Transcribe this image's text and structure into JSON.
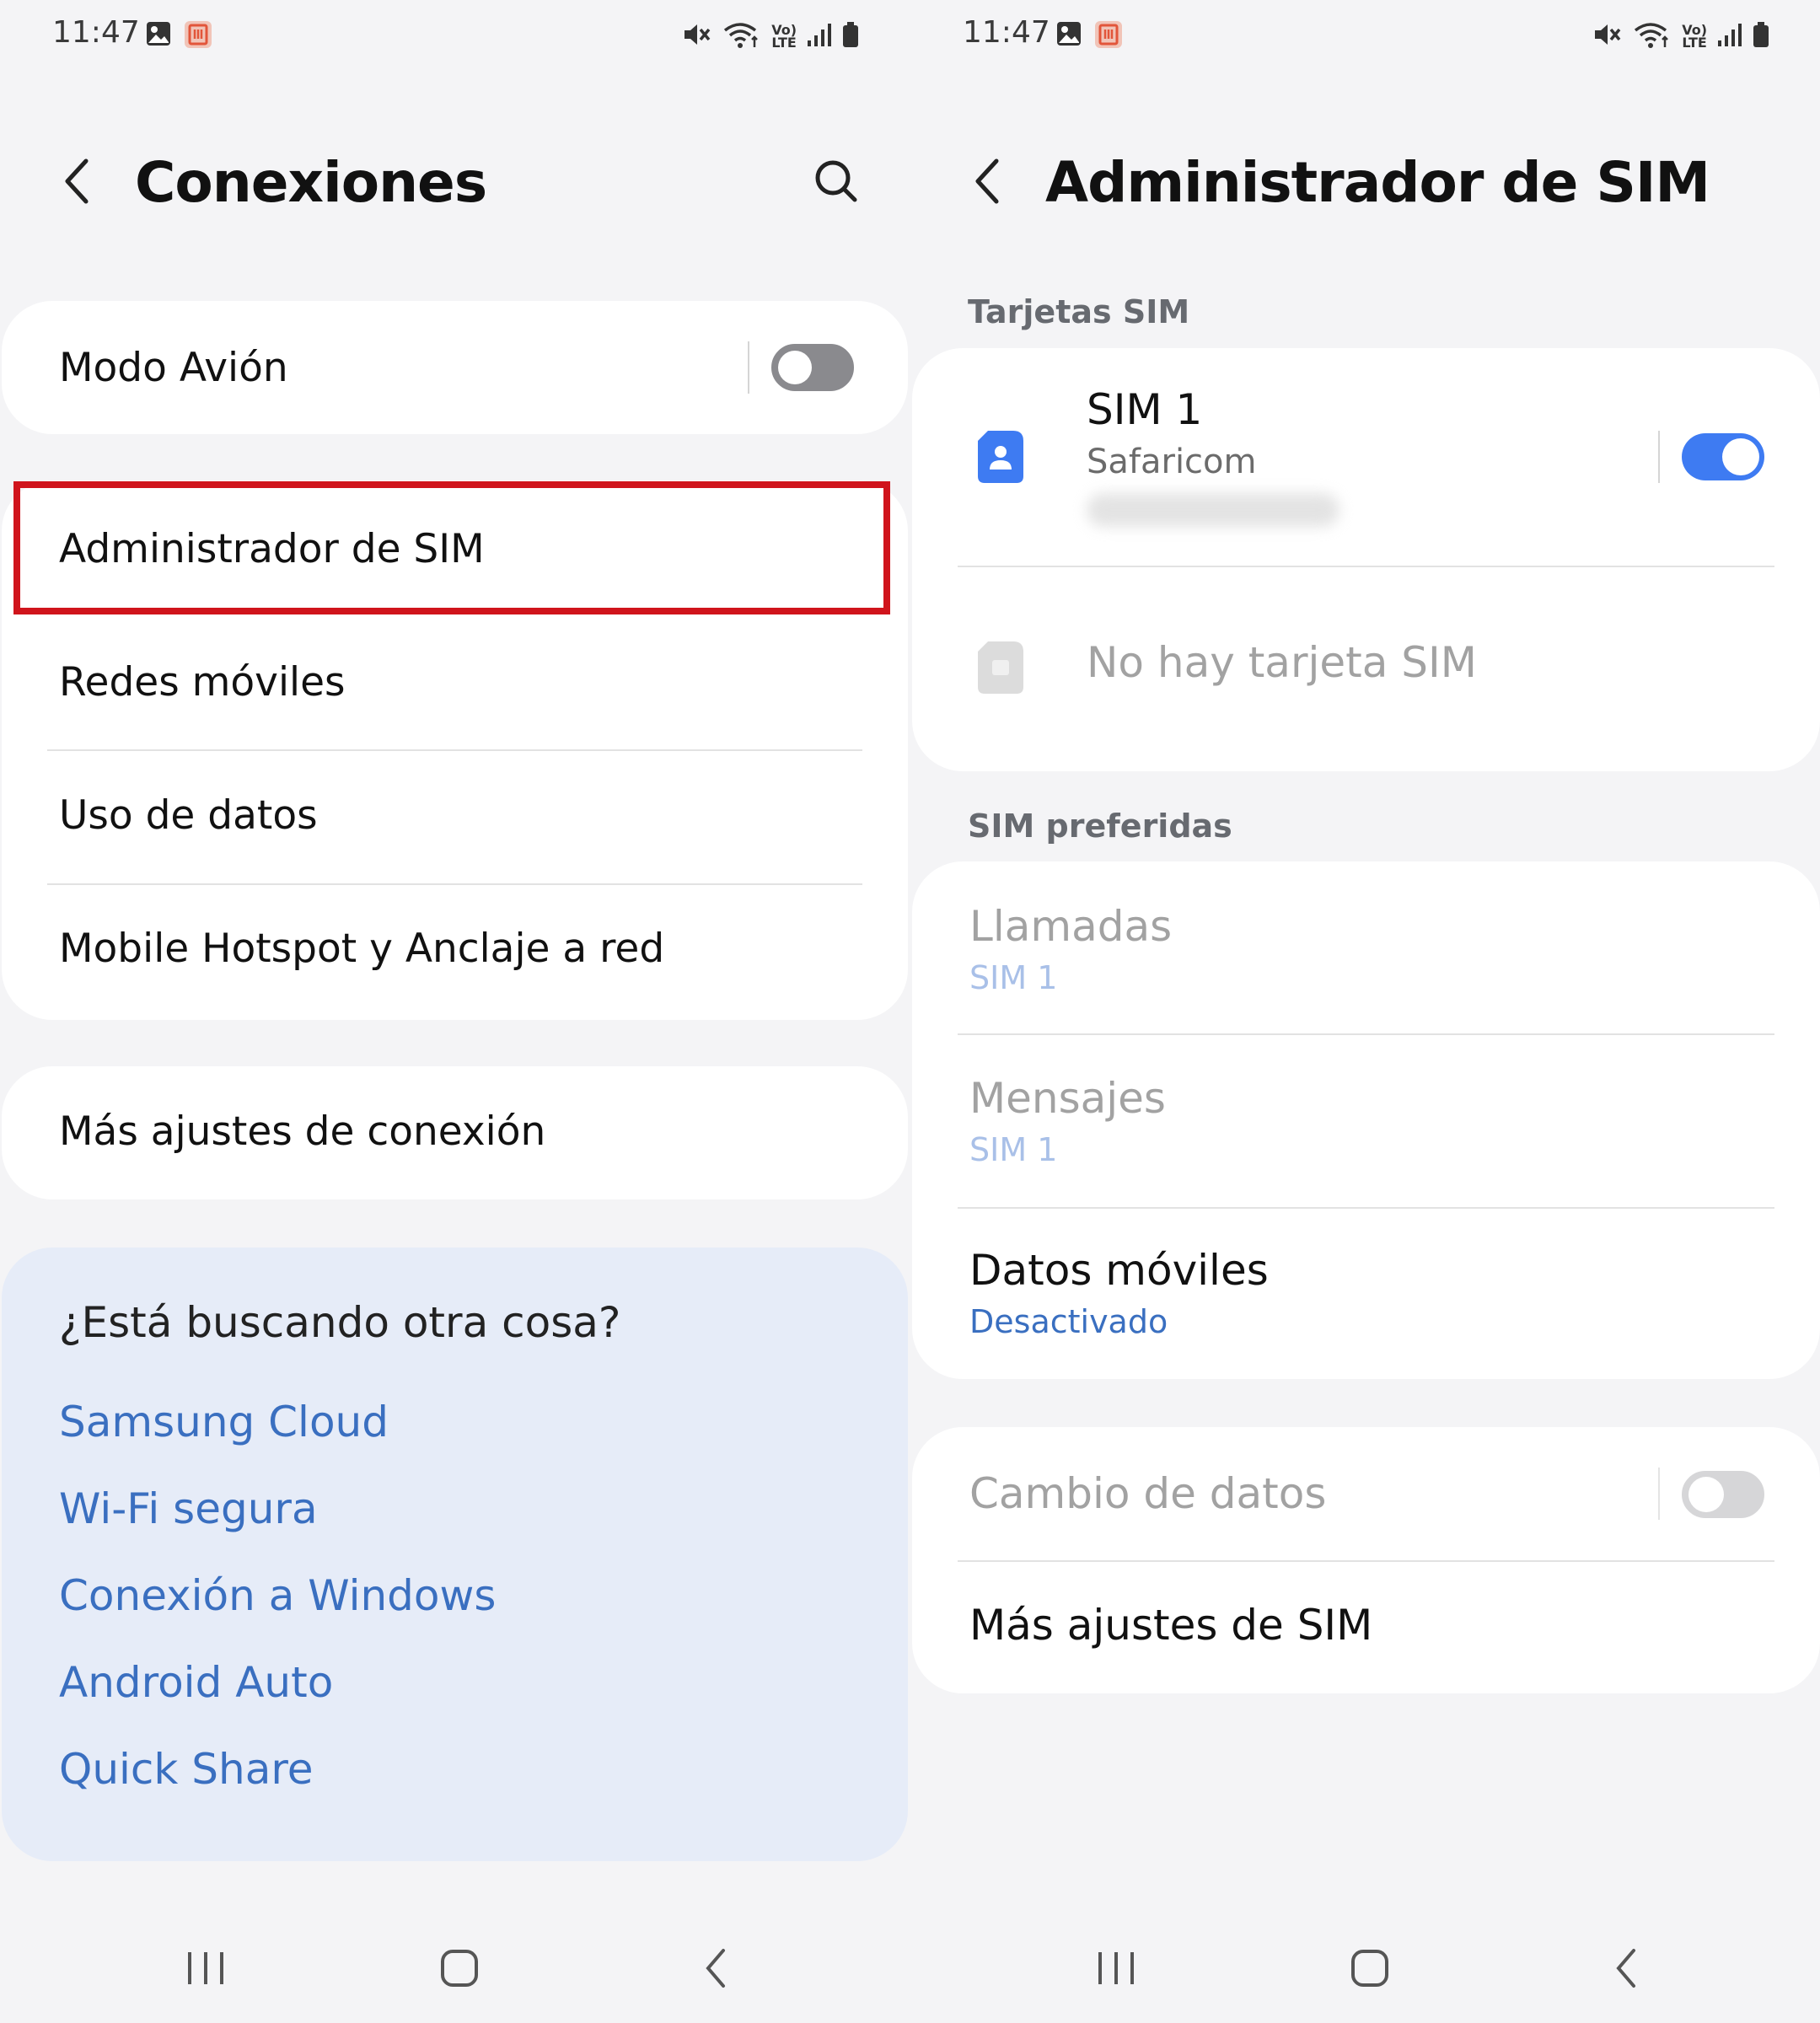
{
  "status_bar": {
    "time": "11:47",
    "volte_label": "Vo)",
    "lte_label": "LTE"
  },
  "left": {
    "header": {
      "title": "Conexiones"
    },
    "airplane": {
      "label": "Modo Avión",
      "enabled": false
    },
    "items": {
      "sim_manager": "Administrador de SIM",
      "mobile_networks": "Redes móviles",
      "data_usage": "Uso de datos",
      "hotspot": "Mobile Hotspot y Anclaje a red"
    },
    "more_settings": "Más ajustes de conexión",
    "suggestions": {
      "title": "¿Está buscando otra cosa?",
      "links": [
        "Samsung Cloud",
        "Wi-Fi segura",
        "Conexión a Windows",
        "Android Auto",
        "Quick Share"
      ]
    }
  },
  "right": {
    "header": {
      "title": "Administrador de SIM"
    },
    "sim_cards": {
      "section_label": "Tarjetas SIM",
      "sim1": {
        "name": "SIM 1",
        "carrier": "Safaricom",
        "enabled": true
      },
      "no_sim": "No hay tarjeta SIM"
    },
    "preferred": {
      "section_label": "SIM preferidas",
      "calls": {
        "label": "Llamadas",
        "value": "SIM 1"
      },
      "messages": {
        "label": "Mensajes",
        "value": "SIM 1"
      },
      "mobile_data": {
        "label": "Datos móviles",
        "value": "Desactivado"
      }
    },
    "data_switch": {
      "label": "Cambio de datos",
      "enabled": false
    },
    "more_sim": "Más ajustes de SIM"
  },
  "colors": {
    "accent": "#3e7bf2",
    "link": "#3a6fc0",
    "highlight": "#d0141c",
    "suggest_bg": "#e6ecf8"
  }
}
